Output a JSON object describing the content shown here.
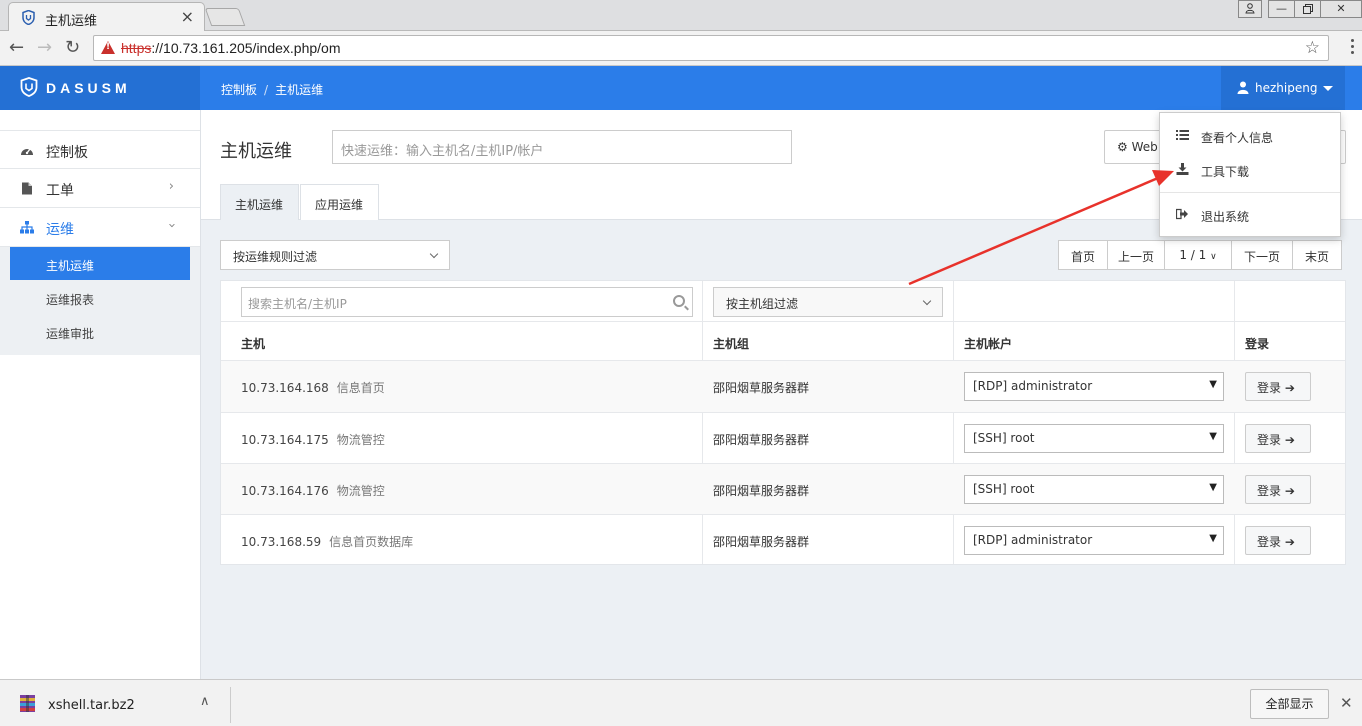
{
  "browser": {
    "tab_title": "主机运维",
    "url_scheme": "https",
    "url_rest": "://10.73.161.205/index.php/om"
  },
  "header": {
    "brand": "DASUSM",
    "breadcrumb": [
      "控制板",
      "主机运维"
    ],
    "user": "hezhipeng"
  },
  "sidebar": {
    "items": [
      {
        "label": "控制板",
        "icon": "dashboard-icon"
      },
      {
        "label": "工单",
        "icon": "document-icon"
      },
      {
        "label": "运维",
        "icon": "sitemap-icon"
      }
    ],
    "sub_items": [
      {
        "label": "主机运维",
        "active": true
      },
      {
        "label": "运维报表",
        "active": false
      },
      {
        "label": "运维审批",
        "active": false
      }
    ]
  },
  "main": {
    "title": "主机运维",
    "quick_placeholder": "快速运维：输入主机名/主机IP/帐户",
    "web_button": "Web",
    "tabs": [
      "主机运维",
      "应用运维"
    ],
    "rule_filter": "按运维规则过滤",
    "pager": {
      "first": "首页",
      "prev": "上一页",
      "current": "1 / 1",
      "next": "下一页",
      "last": "末页"
    },
    "search_placeholder": "搜索主机名/主机IP",
    "group_filter": "按主机组过滤",
    "columns": [
      "主机",
      "主机组",
      "主机帐户",
      "登录"
    ],
    "rows": [
      {
        "ip": "10.73.164.168",
        "name": "信息首页",
        "group": "邵阳烟草服务器群",
        "account": "[RDP] administrator",
        "login": "登录"
      },
      {
        "ip": "10.73.164.175",
        "name": "物流管控",
        "group": "邵阳烟草服务器群",
        "account": "[SSH] root",
        "login": "登录"
      },
      {
        "ip": "10.73.164.176",
        "name": "物流管控",
        "group": "邵阳烟草服务器群",
        "account": "[SSH] root",
        "login": "登录"
      },
      {
        "ip": "10.73.168.59",
        "name": "信息首页数据库",
        "group": "邵阳烟草服务器群",
        "account": "[RDP] administrator",
        "login": "登录"
      }
    ]
  },
  "user_menu": {
    "items": [
      {
        "label": "查看个人信息",
        "icon": "list-icon"
      },
      {
        "label": "工具下载",
        "icon": "download-icon"
      },
      {
        "label": "退出系统",
        "icon": "sign-out-icon"
      }
    ]
  },
  "download_bar": {
    "file": "xshell.tar.bz2",
    "show_all": "全部显示"
  },
  "colors": {
    "primary": "#2b7de9",
    "brand_bg": "#2470d4",
    "annotation_arrow": "#e8322b"
  }
}
